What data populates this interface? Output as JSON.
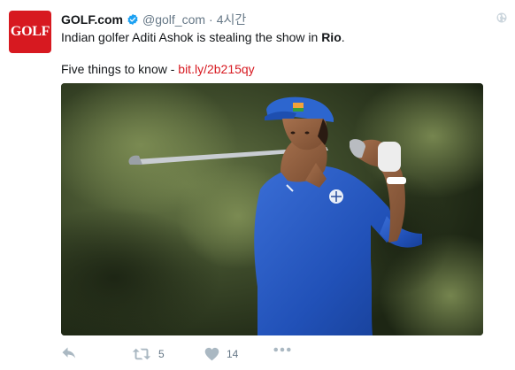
{
  "tweet": {
    "display_name": "GOLF.com",
    "handle": "@golf_com",
    "separator": "·",
    "time": "4시간",
    "avatar_text": "GOLF",
    "text_part1": "Indian golfer Aditi Ashok is stealing the show in ",
    "text_bold": "Rio",
    "text_part2": ".",
    "line2_text": "Five things to know - ",
    "link": "bit.ly/2b215qy",
    "retweet_count": "5",
    "like_count": "14",
    "more_label": "•••",
    "icons": {
      "verified": "verified-badge-icon",
      "globe": "globe-icon",
      "reply": "reply-icon",
      "retweet": "retweet-icon",
      "like": "heart-icon",
      "more": "more-icon"
    },
    "colors": {
      "brand_red": "#d71920",
      "link": "#d71920",
      "verified_blue": "#1da1f2",
      "action_gray": "#aab8c2",
      "secondary_text": "#657786"
    }
  }
}
